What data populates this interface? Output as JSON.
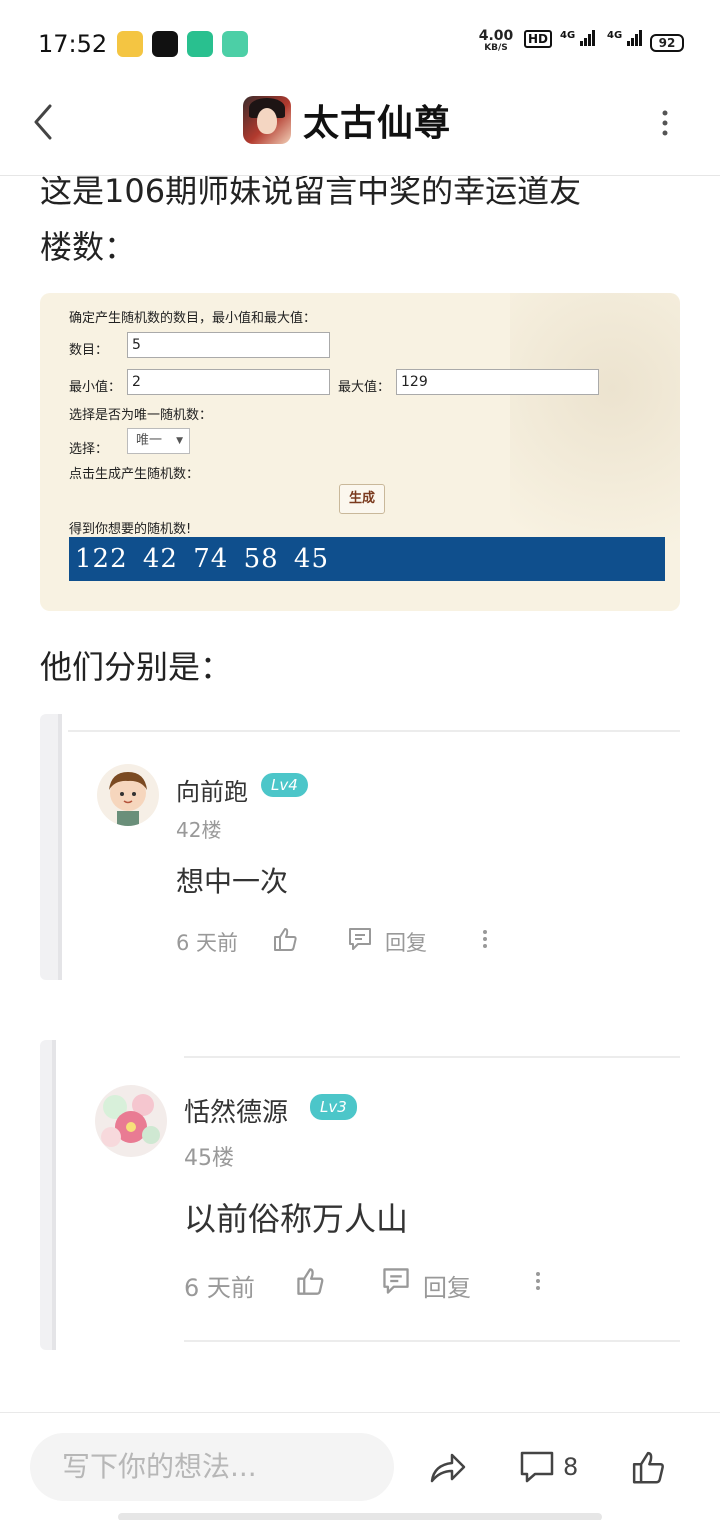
{
  "status": {
    "time": "17:52",
    "net_speed": "4.00",
    "net_unit": "KB/S",
    "hd": "HD",
    "signal1": "4G",
    "signal2": "4G",
    "battery": "92"
  },
  "header": {
    "title": "太古仙尊"
  },
  "post": {
    "partial_line": "这是106期师妹说留言中奖的幸运道友",
    "floors_line": "楼数：",
    "they_are": "他们分别是："
  },
  "random_image": {
    "intro": "确定产生随机数的数目，最小值和最大值：",
    "count_label": "数目：",
    "count_value": "5",
    "min_label": "最小值：",
    "min_value": "2",
    "max_label": "最大值：",
    "max_value": "129",
    "unique_prompt": "选择是否为唯一随机数：",
    "select_label": "选择：",
    "select_value": "唯一",
    "click_prompt": "点击生成产生随机数：",
    "generate_button": "生成",
    "result_label": "得到你想要的随机数!",
    "result_value": "122  42  74  58  45"
  },
  "comments": [
    {
      "name": "向前跑",
      "level": "Lv4",
      "floor": "42楼",
      "text": "想中一次",
      "time": "6 天前",
      "reply": "回复"
    },
    {
      "name": "恬然德源",
      "level": "Lv3",
      "floor": "45楼",
      "text": "以前俗称万人山",
      "time": "6 天前",
      "reply": "回复"
    }
  ],
  "bottom": {
    "input_placeholder": "写下你的想法...",
    "comment_count": "8"
  },
  "colors": {
    "level_badge": "#4cc6c9",
    "result_bar": "#0f4f8d",
    "image_bg": "#f8f2e2"
  }
}
